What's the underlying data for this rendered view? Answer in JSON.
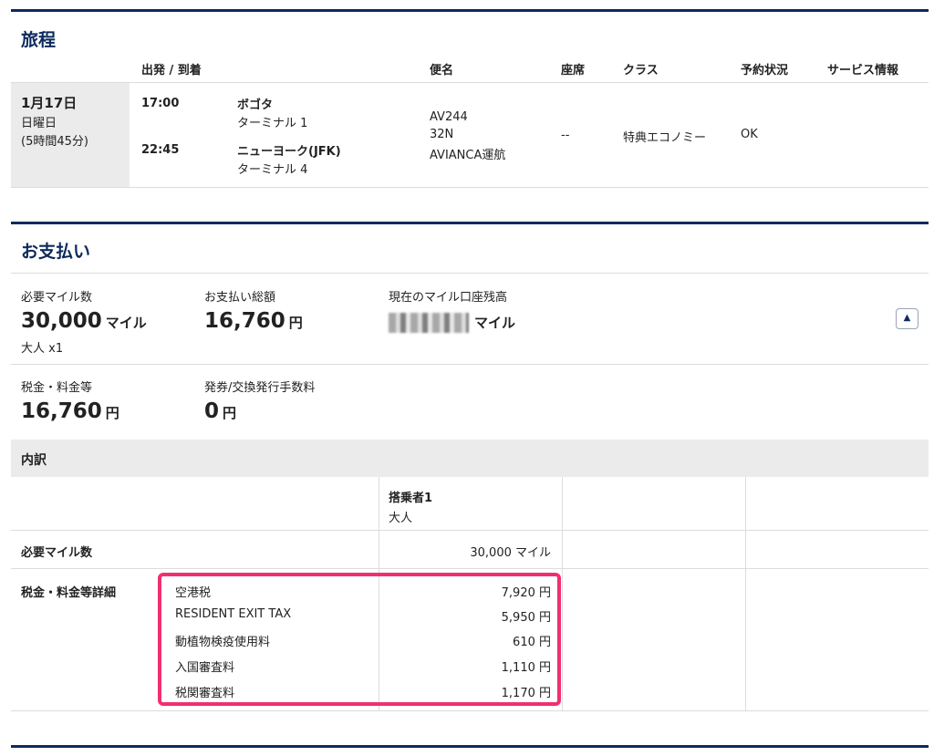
{
  "itinerary": {
    "title": "旅程",
    "headers": {
      "dep_arr": "出発 / 到着",
      "flight": "便名",
      "seat": "座席",
      "class": "クラス",
      "status": "予約状況",
      "service": "サービス情報"
    },
    "date": "1月17日",
    "weekday": "日曜日",
    "duration": "(5時間45分)",
    "dep_time": "17:00",
    "dep_city": "ボゴタ",
    "dep_terminal": "ターミナル 1",
    "arr_time": "22:45",
    "arr_city": "ニューヨーク(JFK)",
    "arr_terminal": "ターミナル 4",
    "flight_no": "AV244",
    "aircraft": "32N",
    "operator": "AVIANCA運航",
    "seat": "--",
    "class": "特典エコノミー",
    "status": "OK"
  },
  "payment": {
    "title": "お支払い",
    "miles_label": "必要マイル数",
    "miles_value": "30,000",
    "miles_unit": "マイル",
    "pax": "大人 x1",
    "total_label": "お支払い総額",
    "total_value": "16,760",
    "total_unit": "円",
    "balance_label": "現在のマイル口座残高",
    "balance_unit": "マイル",
    "tax_label": "税金・料金等",
    "tax_value": "16,760",
    "tax_unit": "円",
    "fee_label": "発券/交換発行手数料",
    "fee_value": "0",
    "fee_unit": "円",
    "toggle_icon": "▲"
  },
  "breakdown": {
    "title": "内訳",
    "passenger": "搭乗者1",
    "passenger_type": "大人",
    "miles_label": "必要マイル数",
    "miles_value": "30,000 マイル",
    "tax_detail_label": "税金・料金等詳細",
    "items": [
      {
        "name": "空港税",
        "amount": "7,920 円"
      },
      {
        "name": "RESIDENT EXIT TAX",
        "amount": "5,950 円"
      },
      {
        "name": "動植物検疫使用料",
        "amount": "610 円"
      },
      {
        "name": "入国審査料",
        "amount": "1,110 円"
      },
      {
        "name": "税関審査料",
        "amount": "1,170 円"
      }
    ],
    "highlight_color": "#f0306e"
  },
  "colors": {
    "navy": "#0d2a5c",
    "gray_bg": "#ebebeb"
  }
}
